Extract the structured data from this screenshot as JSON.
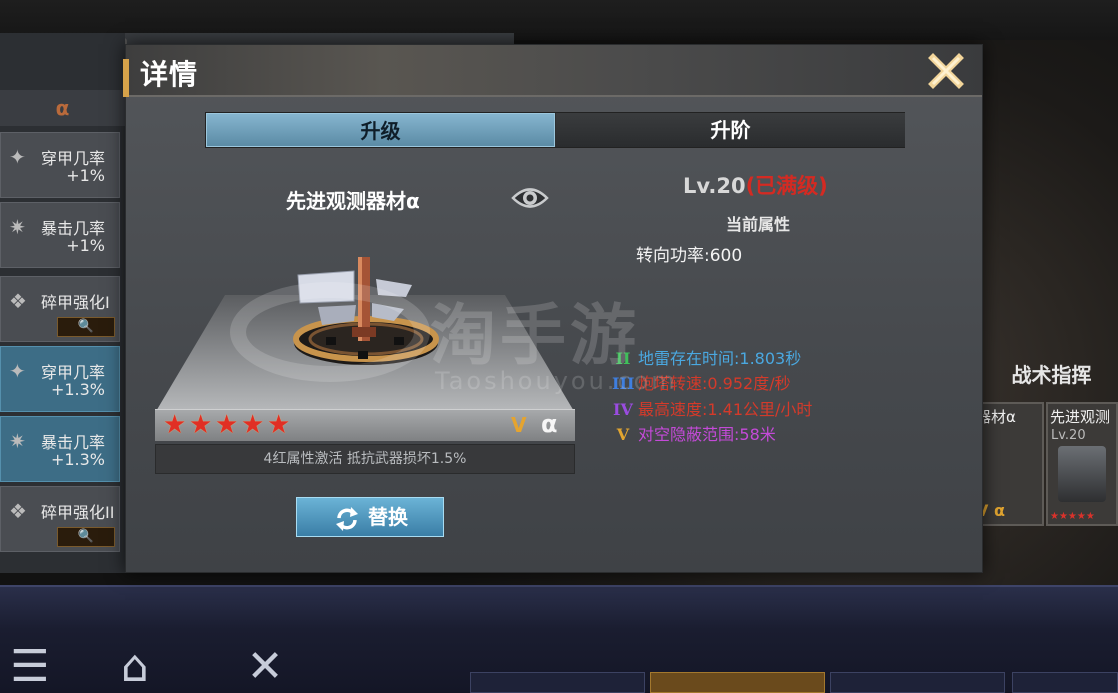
{
  "dialog": {
    "title": "详情",
    "close_glyph": "✕",
    "tabs": [
      {
        "label": "升级",
        "active": true
      },
      {
        "label": "升阶",
        "active": false
      }
    ]
  },
  "item": {
    "name": "先进观测器材α",
    "star_count": 5,
    "grade_mark": "V",
    "alpha_mark": "α",
    "set_bonus": "4红属性激活    抵抗武器损坏1.5%",
    "replace_label": "替换"
  },
  "stats": {
    "level": "Lv.20",
    "level_status": "(已满级)",
    "heading": "当前属性",
    "base": "转向功率:600",
    "tiers": [
      {
        "icon": "II",
        "text": "地雷存在时间:1.803秒",
        "icon_color": "#3fbf5a",
        "text_color": "#4aa8e0"
      },
      {
        "icon": "III",
        "text": "炮塔转速:0.952度/秒",
        "icon_color": "#3f7fe0",
        "text_color": "#d43a2a"
      },
      {
        "icon": "IV",
        "text": "最高速度:1.41公里/小时",
        "icon_color": "#9a4ce0",
        "text_color": "#d43a2a"
      },
      {
        "icon": "V",
        "text": "对空隐蔽范围:58米",
        "icon_color": "#e2a530",
        "text_color": "#c44ad8"
      }
    ]
  },
  "background": {
    "left_alpha": "α",
    "left_items": [
      {
        "name": "穿甲几率",
        "value": "+1%",
        "style": "grey"
      },
      {
        "name": "暴击几率",
        "value": "+1%",
        "style": "grey"
      },
      {
        "name": "碎甲强化I",
        "value": "",
        "style": "grey",
        "button": "🔍"
      },
      {
        "name": "穿甲几率",
        "value": "+1.3%",
        "style": "blue"
      },
      {
        "name": "暴击几率",
        "value": "+1.3%",
        "style": "blue"
      },
      {
        "name": "碎甲强化II",
        "value": "",
        "style": "grey",
        "button": "🔍"
      }
    ],
    "right_title": "战术指挥",
    "right_cards": [
      {
        "name": "器材α",
        "lv": "",
        "marks": "V α"
      },
      {
        "name": "先进观测",
        "lv": "Lv.20",
        "marks": ""
      }
    ]
  },
  "watermark": {
    "main": "淘手游",
    "sub": "Taoshouyou.com"
  },
  "colors": {
    "accent_gold": "#d6a24a",
    "tab_active": "#6e9fbb",
    "maxed_red": "#d42a22",
    "star_red": "#e12f24"
  }
}
